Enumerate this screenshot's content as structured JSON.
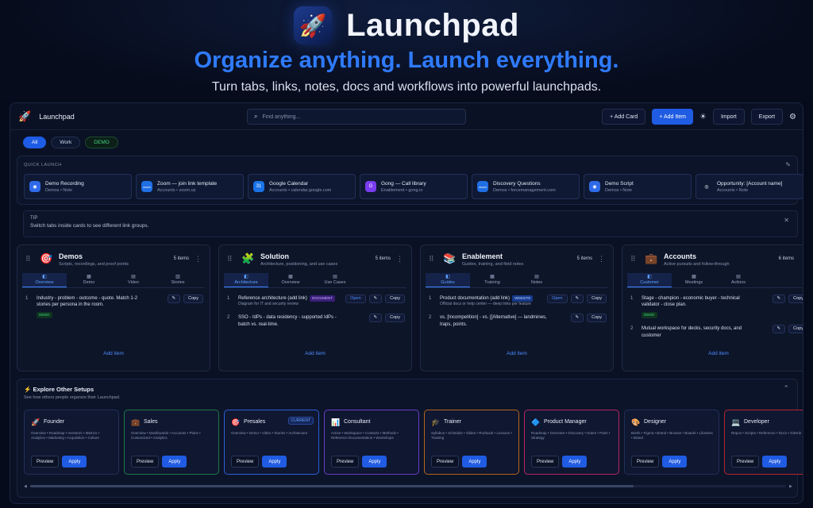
{
  "hero": {
    "logo_icon": "rocket-icon",
    "brand": "Launchpad",
    "tagline": "Organize anything. Launch everything.",
    "subtagline": "Turn tabs, links, notes, docs and workflows into powerful launchpads."
  },
  "topbar": {
    "title": "Launchpad",
    "search_placeholder": "Find anything...",
    "add_card": "+ Add Card",
    "add_item": "+ Add Item",
    "import": "Import",
    "export": "Export"
  },
  "filters": [
    "All",
    "Work",
    "DEMO"
  ],
  "quick_launch": {
    "heading": "QUICK LAUNCH",
    "items": [
      {
        "title": "Demo Recording",
        "sub": "Demos • Note",
        "color": "#2f6be8",
        "icon": "◉"
      },
      {
        "title": "Zoom — join link template",
        "sub": "Accounts • zoom.us",
        "color": "#1f6fe5",
        "icon": "zoom"
      },
      {
        "title": "Google Calendar",
        "sub": "Accounts • calendar.google.com",
        "color": "#1a73e8",
        "icon": "31"
      },
      {
        "title": "Gong — Call library",
        "sub": "Enablement • gong.io",
        "color": "#7a3df0",
        "icon": "G"
      },
      {
        "title": "Discovery Questions",
        "sub": "Demos • forcemanagement.com",
        "color": "#1f6fe5",
        "icon": "zoom"
      },
      {
        "title": "Demo Script",
        "sub": "Demos • Note",
        "color": "#2f6be8",
        "icon": "◉"
      },
      {
        "title": "Opportunity: [Account name]",
        "sub": "Accounts • Note",
        "color": "#0f1933",
        "icon": "◎"
      }
    ]
  },
  "tip": {
    "title": "TIP",
    "body": "Switch tabs inside cards to see different link groups."
  },
  "cards": [
    {
      "emoji": "🎯",
      "title": "Demos",
      "sub": "Scripts, recordings, and proof points",
      "count": "5 items",
      "tabs": [
        "Overview",
        "Demo",
        "Video",
        "Stories"
      ],
      "rows": [
        {
          "num": "1",
          "text": "Industry - problem - outcome - quote. Match 1-2 stories per persona in the room.",
          "tag": "DEMO"
        }
      ],
      "add": "Add item"
    },
    {
      "emoji": "🧩",
      "title": "Solution",
      "sub": "Architecture, positioning, and use cases",
      "count": "5 items",
      "tabs": [
        "Architecture",
        "Overview",
        "Use Cases"
      ],
      "rows": [
        {
          "num": "1",
          "text": "Reference architecture (add link)",
          "sub": "Diagram for IT and security review",
          "tag": "DOCUMENT",
          "open": "Open"
        },
        {
          "num": "2",
          "text": "SSO - IdPs - data residency - supported IdPs - batch vs. real-time."
        }
      ],
      "add": "Add item"
    },
    {
      "emoji": "📚",
      "title": "Enablement",
      "sub": "Guides, training, and field notes",
      "count": "5 items",
      "tabs": [
        "Guides",
        "Training",
        "Notes"
      ],
      "rows": [
        {
          "num": "1",
          "text": "Product documentation (add link)",
          "sub": "Official docs or help center — deep links per feature",
          "tag": "WEBSITE",
          "open": "Open"
        },
        {
          "num": "2",
          "text": "vs. [Incompetition] - vs. [[Alternative] — landmines, traps, points."
        }
      ],
      "add": "Add item"
    },
    {
      "emoji": "💼",
      "title": "Accounts",
      "sub": "Active pursuits and follow-through",
      "count": "6 items",
      "tabs": [
        "Customer",
        "Meetings",
        "Actions"
      ],
      "rows": [
        {
          "num": "1",
          "text": "Stage - champion - economic buyer - technical validator - close plan.",
          "tag": "DEMO"
        },
        {
          "num": "2",
          "text": "Mutual workspace for decks, security docs, and customer"
        }
      ],
      "add": "Add item"
    }
  ],
  "copy_label": "Copy",
  "explore": {
    "title": "Explore Other Setups",
    "sub": "See how others people organize their Launchpad.",
    "preview": "Preview",
    "apply": "Apply",
    "setups": [
      {
        "emoji": "🚀",
        "name": "Founder",
        "desc": "Overview • Roadmap • Investors • Metrics • Analytics • Marketing • Acquisition • Culture",
        "border": "#22305a"
      },
      {
        "emoji": "💼",
        "name": "Sales",
        "desc": "Overview • Dashboards • Accounts • Plans • Customized • Analytics",
        "border": "#1f7a45"
      },
      {
        "emoji": "🎯",
        "name": "Presales",
        "desc": "Overview • Demo • Video • Stories • Architecture",
        "border": "#2d5fd8",
        "badge": "CURRENT"
      },
      {
        "emoji": "📊",
        "name": "Consultant",
        "desc": "Active • Workspace • Contacts • Methods • Reference Documentation • Workshops",
        "border": "#6a3cc8"
      },
      {
        "emoji": "🎓",
        "name": "Trainer",
        "desc": "Syllabus • Schedule • Slides • Runbook • Lessons • Training",
        "border": "#b8631e"
      },
      {
        "emoji": "🔷",
        "name": "Product Manager",
        "desc": "Roadmap • Overview • Discovery • Notes • Parts • Strategy",
        "border": "#b8246a"
      },
      {
        "emoji": "🎨",
        "name": "Designer",
        "desc": "Briefs • Figma • Brand • Browse • Boards • Libraries • Brand",
        "border": "#22305a"
      },
      {
        "emoji": "💻",
        "name": "Developer",
        "desc": "Repos • Scripts • Reference • Docs • GitHub",
        "border": "#b8242e"
      }
    ]
  }
}
